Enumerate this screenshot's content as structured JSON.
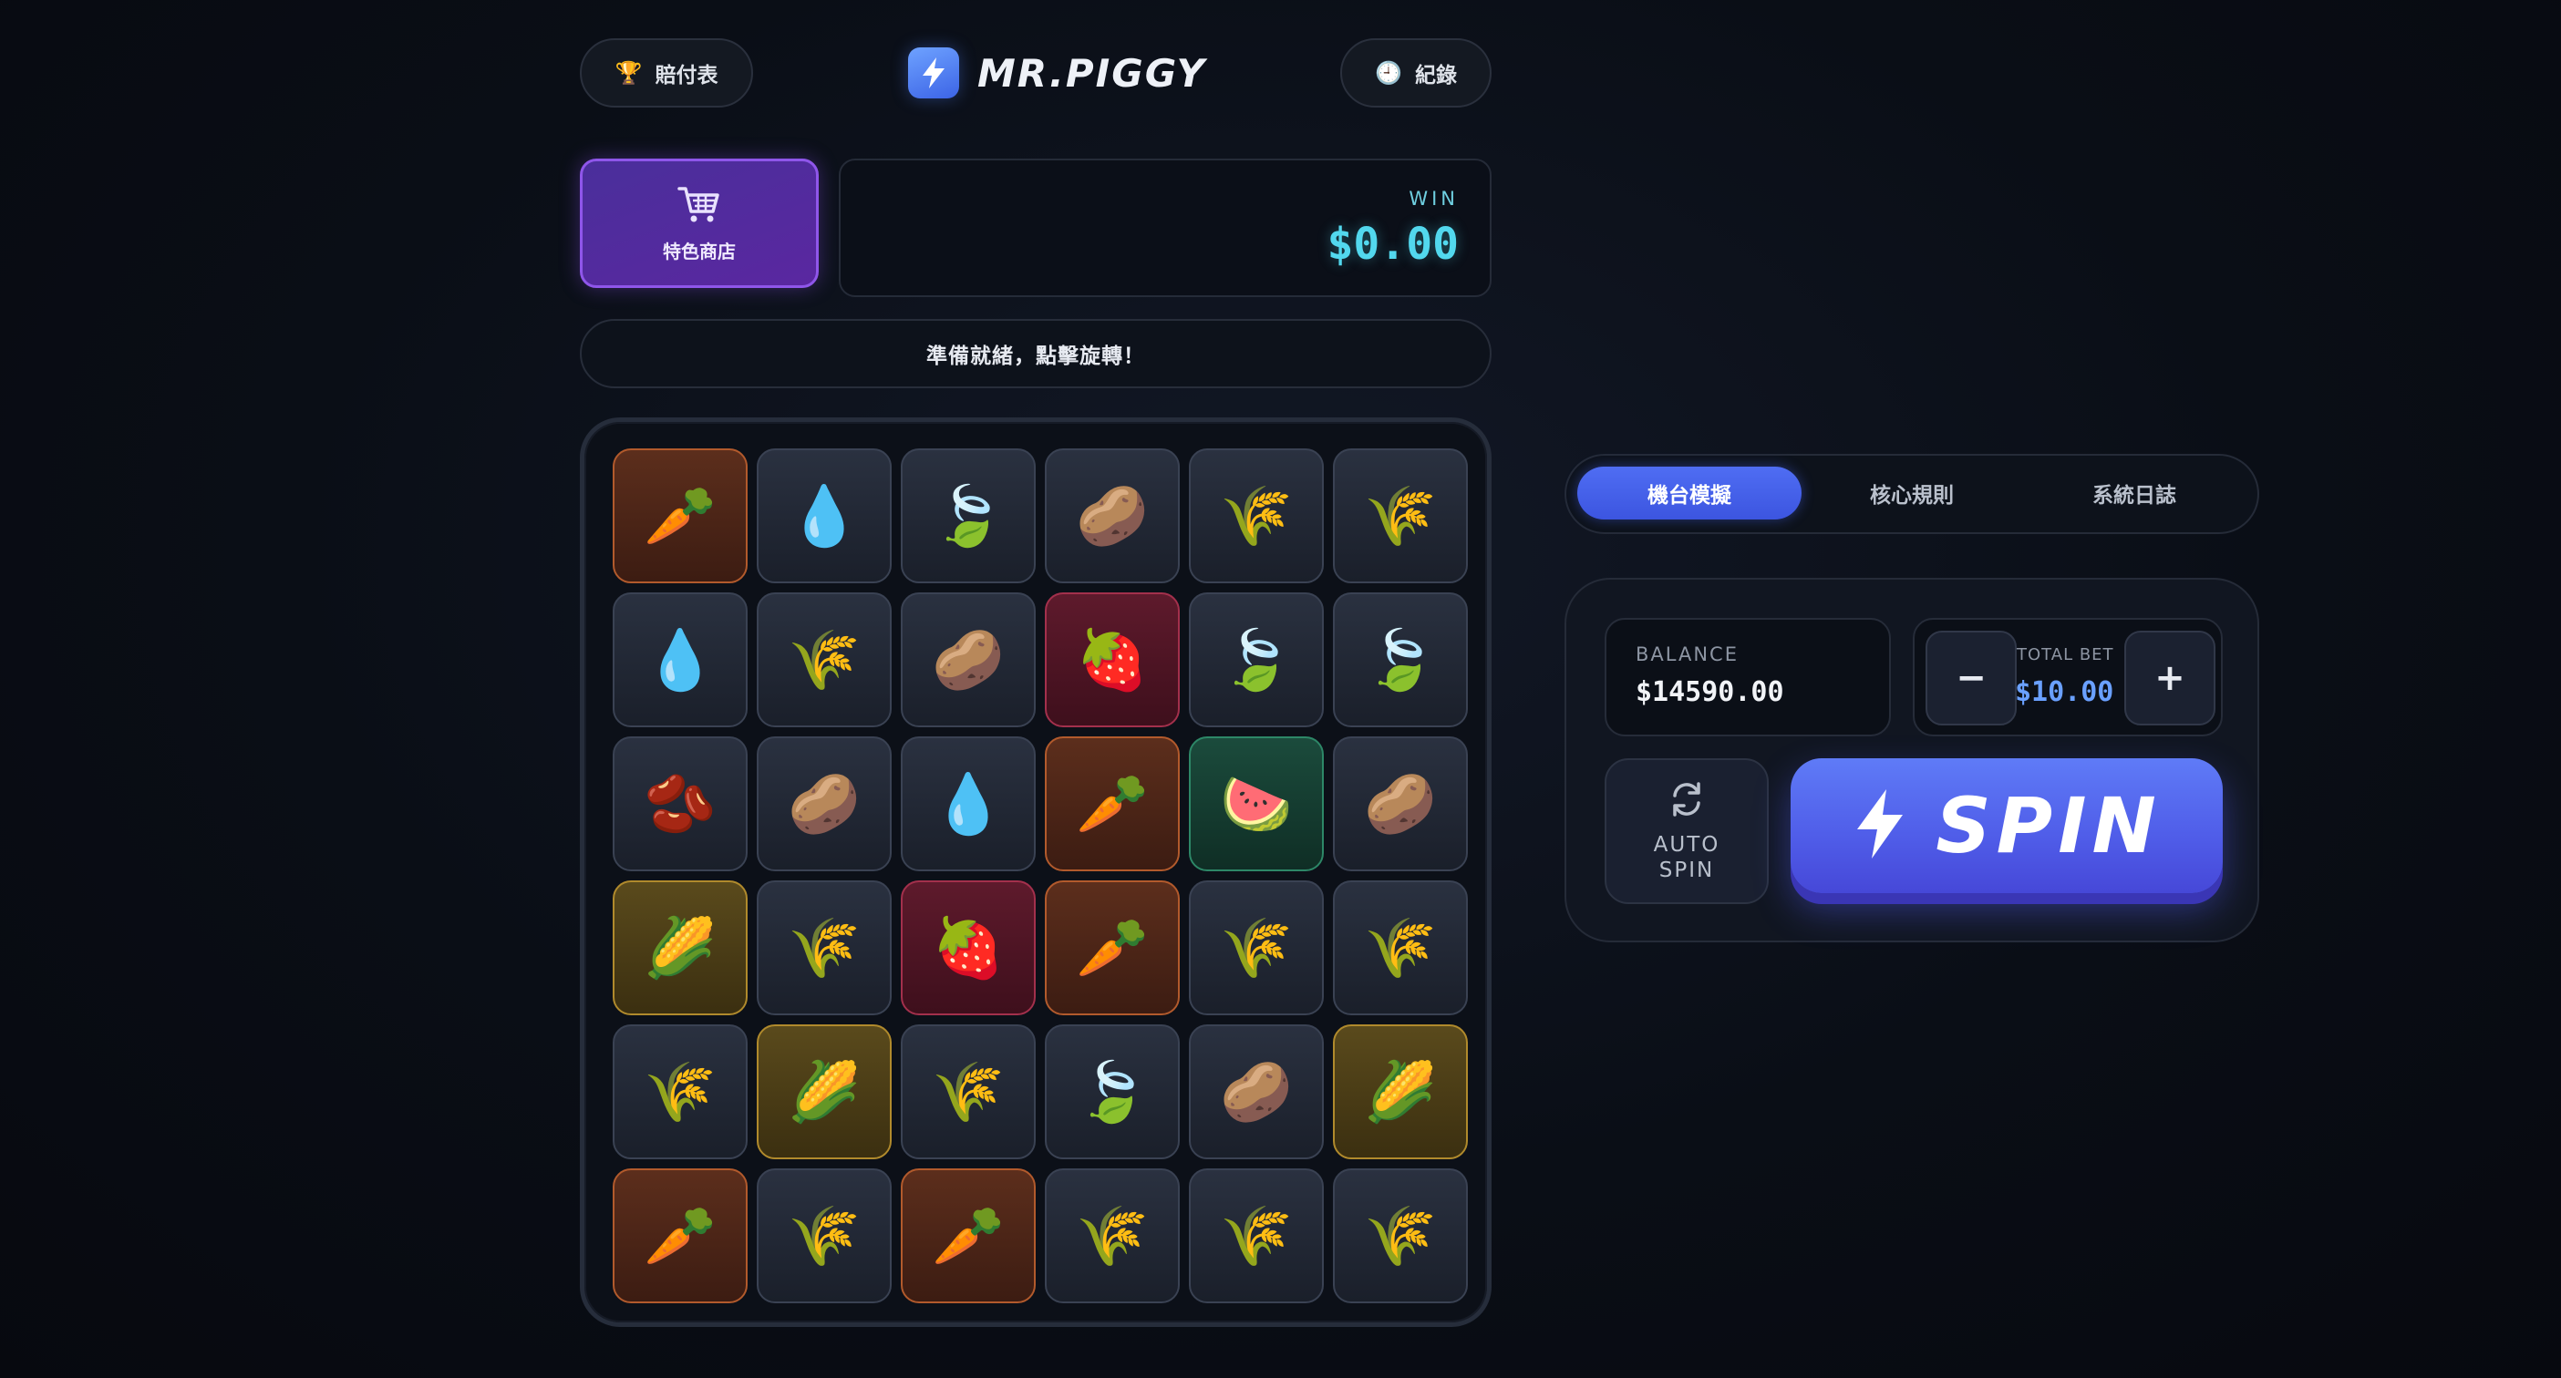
{
  "header": {
    "paytable_label": "賠付表",
    "paytable_icon": "trophy-icon",
    "logo_text": "MR.PIGGY",
    "logo_icon": "lightning-icon",
    "history_label": "紀錄",
    "history_icon": "clock-icon"
  },
  "shop": {
    "label": "特色商店",
    "icon": "shopping-cart-icon"
  },
  "win": {
    "label": "WIN",
    "value": "$0.00"
  },
  "status": {
    "message": "準備就緒，點擊旋轉！"
  },
  "grid": {
    "rows": [
      [
        "carrot",
        "water",
        "leaf",
        "potato",
        "wheat",
        "wheat"
      ],
      [
        "water",
        "wheat",
        "potato",
        "strawberry",
        "leaf",
        "leaf"
      ],
      [
        "beans",
        "potato",
        "water",
        "carrot",
        "watermelon",
        "potato"
      ],
      [
        "corn",
        "wheat",
        "strawberry",
        "carrot",
        "wheat",
        "wheat"
      ],
      [
        "wheat",
        "corn",
        "wheat",
        "leaf",
        "potato",
        "corn"
      ],
      [
        "carrot",
        "wheat",
        "carrot",
        "wheat",
        "wheat",
        "wheat"
      ]
    ],
    "symbols": {
      "carrot": "🥕",
      "water": "💧",
      "leaf": "🍃",
      "potato": "🥔",
      "wheat": "🌾",
      "strawberry": "🍓",
      "beans": "🫘",
      "watermelon": "🍉",
      "corn": "🌽"
    }
  },
  "tabs": [
    "機台模擬",
    "核心規則",
    "系統日誌"
  ],
  "active_tab": 0,
  "balance": {
    "label": "BALANCE",
    "value": "$14590.00"
  },
  "bet": {
    "label": "TOTAL BET",
    "value": "$10.00",
    "minus": "−",
    "plus": "+"
  },
  "auto_spin": {
    "line1": "AUTO",
    "line2": "SPIN",
    "icon": "refresh-icon"
  },
  "spin": {
    "label": "SPIN",
    "icon": "lightning-icon"
  },
  "colors": {
    "accent": "#4f6df3",
    "win": "#52d8ee",
    "shop": "#5a27a0"
  }
}
